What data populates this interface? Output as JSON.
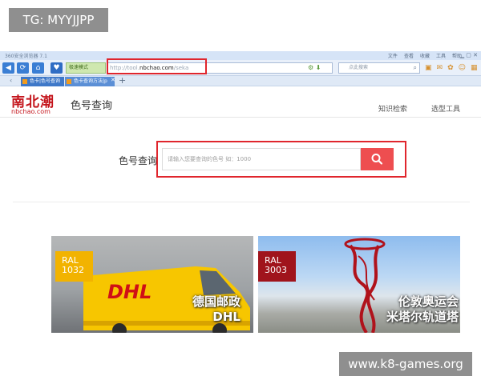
{
  "watermarks": {
    "tag": "TG: MYYJJPP",
    "site": "www.k8-games.org"
  },
  "browser": {
    "title": "360安全浏览器 7.1",
    "menu": [
      "文件",
      "查看",
      "收藏",
      "工具",
      "帮助"
    ],
    "mode_button": "极速模式",
    "url_prefix": "http://tool.",
    "url_domain": "nbchao.com",
    "url_suffix": "/seka",
    "search_placeholder": "点此搜索",
    "tabs": [
      {
        "label": "色卡|色号查询"
      },
      {
        "label": "色卡查询方法|p"
      }
    ]
  },
  "site": {
    "logo_cn": "南北潮",
    "logo_en": "nbchao.com",
    "title": "色号查询",
    "nav": {
      "knowledge": "知识检索",
      "tools": "选型工具"
    },
    "search_label": "色号查询",
    "search_placeholder": "请输入您要查询的色号 如：1000"
  },
  "cards": [
    {
      "ral_label": "RAL",
      "ral_code": "1032",
      "caption_line1": "德国邮政",
      "caption_line2": "DHL",
      "brand": "DHL"
    },
    {
      "ral_label": "RAL",
      "ral_code": "3003",
      "caption_line1": "伦敦奥运会",
      "caption_line2": "米塔尔轨道塔"
    }
  ],
  "colors": {
    "accent_red": "#e0262d",
    "search_button": "#ee4e50",
    "ral_1032": "#f2b300",
    "ral_3003": "#a0141c",
    "logo_red": "#c4151c"
  }
}
